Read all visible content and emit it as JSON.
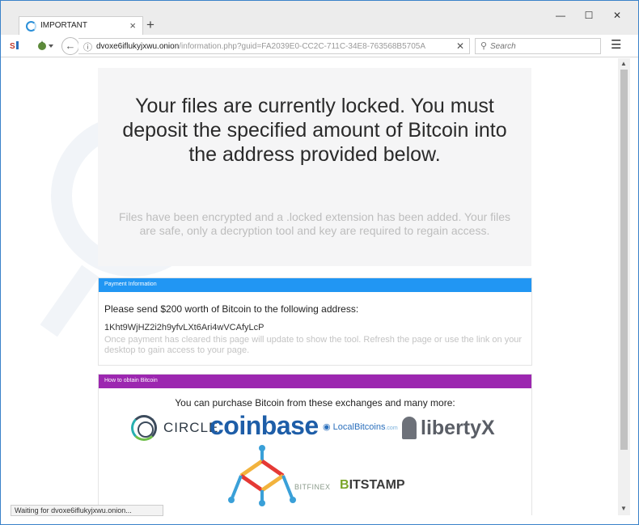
{
  "browser": {
    "tab_title": "IMPORTANT",
    "tab_close": "×",
    "new_tab": "+",
    "window_controls": {
      "minimize": "—",
      "maximize": "☐",
      "close": "✕"
    },
    "url_domain": "dvoxe6iflukyjxwu.onion",
    "url_path": "/information.php?guid=FA2039E0-CC2C-711C-34E8-763568B5705A",
    "search_placeholder": "Search",
    "status_text": "Waiting for dvoxe6iflukyjxwu.onion..."
  },
  "page": {
    "hero_title": "Your files are currently locked. You must deposit the specified amount of Bitcoin into the address provided below.",
    "hero_subtitle": "Files have been encrypted and a .locked extension has been added. Your files are safe, only a decryption tool and key are required to regain access.",
    "payment": {
      "header": "Payment Information",
      "instruction": "Please send $200 worth of Bitcoin to the following address:",
      "address": "1Kht9WjHZ2i2h9yfvLXt6Ari4wVCAfyLcP",
      "note": "Once payment has cleared this page will update to show the tool. Refresh the page or use the link on your desktop to gain access to your page."
    },
    "obtain": {
      "header": "How to obtain Bitcoin",
      "intro": "You can purchase Bitcoin from these exchanges and many more:",
      "logos": {
        "circle": "CIRCLE",
        "coinbase": "coinbase",
        "localbitcoins": "LocalBitcoins",
        "localbitcoins_suffix": ".com",
        "libertyx": "libertyX",
        "bitfinex": "BITFINEX",
        "bitstamp_b": "B",
        "bitstamp_rest": "ITSTAMP"
      }
    }
  },
  "colors": {
    "payment_header": "#2196f3",
    "obtain_header": "#9c27b0",
    "coinbase": "#1e5ea8"
  },
  "icons": [
    "loading-tab-icon",
    "extension-icon",
    "tor-onion-icon",
    "back-arrow-icon",
    "info-icon",
    "clear-icon",
    "search-icon",
    "hamburger-menu-icon"
  ]
}
